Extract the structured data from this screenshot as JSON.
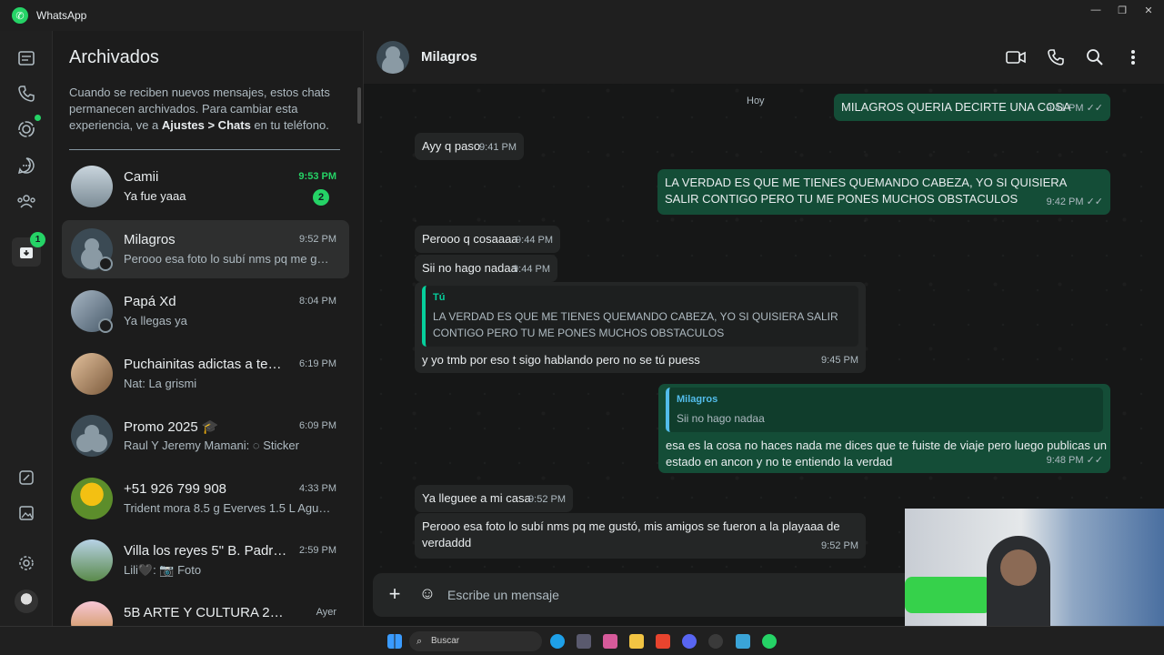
{
  "window": {
    "title": "WhatsApp",
    "controls": {
      "minimize": "—",
      "maximize": "❐",
      "close": "✕"
    }
  },
  "rail": {
    "status_badge": "1"
  },
  "archived": {
    "title": "Archivados",
    "note_pre": "Cuando se reciben nuevos mensajes, estos chats permanecen archivados. Para cambiar esta experiencia, ve a ",
    "note_bold1": "Ajustes > Chats",
    "note_post": " en tu teléfono."
  },
  "chats": [
    {
      "name": "Camii",
      "time": "9:53 PM",
      "preview": "Ya fue yaaa",
      "unread": "2"
    },
    {
      "name": "Milagros",
      "time": "9:52 PM",
      "preview": "Perooo esa foto lo subí nms pq me gust..."
    },
    {
      "name": "Papá Xd",
      "time": "8:04 PM",
      "preview": "Ya llegas ya"
    },
    {
      "name": "Puchainitas adictas a temu ...",
      "time": "6:19 PM",
      "preview": "Nat: La grismi"
    },
    {
      "name": "Promo 2025 🎓",
      "time": "6:09 PM",
      "preview": "Raul Y Jeremy Mamani: ◌ Sticker"
    },
    {
      "name": "+51 926 799 908",
      "time": "4:33 PM",
      "preview": "Trident mora 8.5 g  Everves 1.5 L Agua ..."
    },
    {
      "name": "Villa los reyes 5\" B. Padres ...",
      "time": "2:59 PM",
      "preview": "Lili🖤: 📷 Foto"
    },
    {
      "name": "5B ARTE Y CULTURA 2025",
      "time": "Ayer",
      "preview": ""
    }
  ],
  "conversation": {
    "contact": "Milagros",
    "day": "Hoy",
    "messages": [
      {
        "text": "MILAGROS QUERIA DECIRTE UNA COSA",
        "time": "9:41 PM",
        "ticks": "✓✓"
      },
      {
        "text": "Ayy q paso",
        "time": "9:41 PM"
      },
      {
        "text": "LA VERDAD ES QUE ME TIENES QUEMANDO CABEZA, YO SI QUISIERA SALIR CONTIGO PERO TU ME PONES MUCHOS OBSTACULOS",
        "time": "9:42 PM",
        "ticks": "✓✓"
      },
      {
        "text": "Perooo q cosaaaa",
        "time": "9:44 PM"
      },
      {
        "text": "Sii no hago nadaa",
        "time": "9:44 PM"
      },
      {
        "quote_name": "Tú",
        "quote_text": "LA VERDAD ES QUE ME TIENES QUEMANDO CABEZA, YO SI QUISIERA SALIR CONTIGO PERO TU ME PONES MUCHOS OBSTACULOS",
        "text": "y yo tmb por eso t sigo hablando pero no se tú puess",
        "time": "9:45 PM"
      },
      {
        "quote_name": "Milagros",
        "quote_text": "Sii no hago nadaa",
        "text": "esa es la cosa no haces nada me dices que te fuiste de viaje pero luego publicas un estado en ancon y no te entiendo la verdad",
        "time": "9:48 PM",
        "ticks": "✓✓"
      },
      {
        "text": "Ya lleguee a mi casa",
        "time": "9:52 PM"
      },
      {
        "text": "Perooo esa foto lo subí nms pq me gustó, mis amigos se fueron a la playaaa de verdaddd",
        "time": "9:52 PM"
      }
    ]
  },
  "composer": {
    "placeholder": "Escribe un mensaje"
  },
  "taskbar": {
    "search_label": "Buscar"
  },
  "colors": {
    "accent": "#25d366",
    "outgoing_bubble": "#144d37",
    "incoming_bubble": "#242626"
  }
}
